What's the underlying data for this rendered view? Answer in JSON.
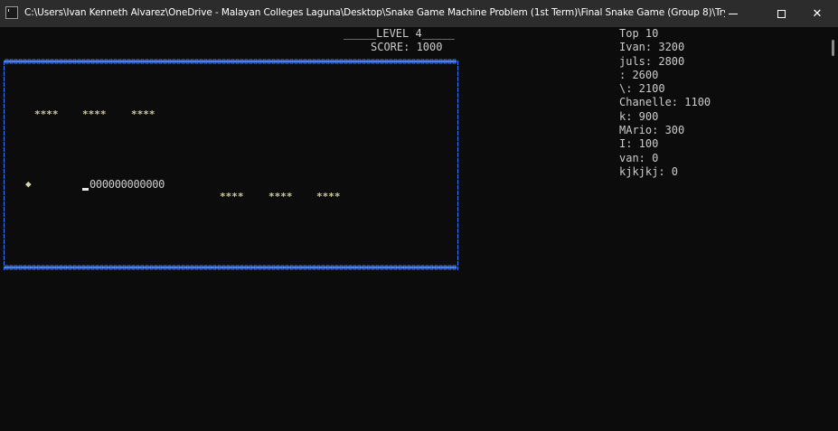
{
  "window": {
    "title": "C:\\Users\\Ivan Kenneth Alvarez\\OneDrive - Malayan Colleges Laguna\\Desktop\\Snake Game Machine Problem (1st Term)\\Final Snake Game (Group 8)\\Try...",
    "close_label": "✕"
  },
  "game": {
    "level_text": "_____LEVEL 4_____",
    "score_text": "SCORE: 1000",
    "obstacles": [
      "****",
      "****",
      "****",
      "****",
      "****",
      "****"
    ],
    "food_glyph": "◆",
    "snake_body": "000000000000"
  },
  "leaderboard": {
    "title": "Top 10",
    "entries": [
      "Ivan: 3200",
      "juls: 2800",
      ": 2600",
      "\\: 2100",
      "Chanelle: 1100",
      "k: 900",
      "MArio: 300",
      "I: 100",
      "van: 0",
      "kjkjkj: 0"
    ]
  },
  "colors": {
    "background": "#0c0c0c",
    "titlebar": "#2c2c2c",
    "text": "#cccccc",
    "border": "#3b78ff",
    "obstacle": "#cdc9a0"
  },
  "icons": {
    "app": "console-icon",
    "minimize": "minimize-icon",
    "maximize": "maximize-icon",
    "close": "close-icon"
  }
}
